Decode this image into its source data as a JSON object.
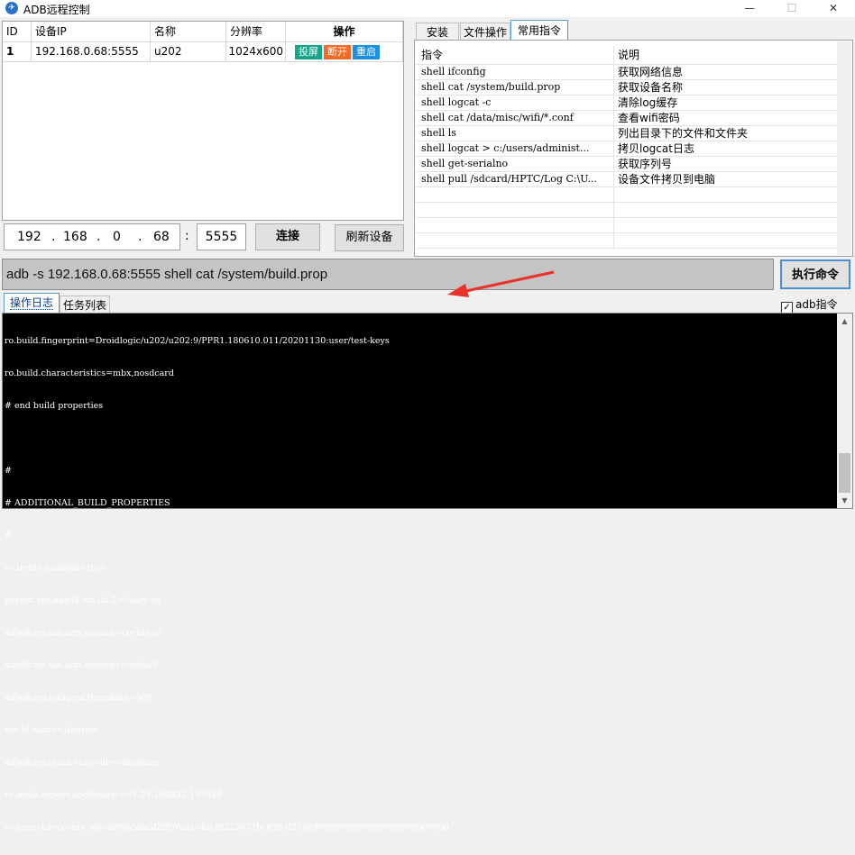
{
  "window": {
    "title": "ADB远程控制",
    "min": "—",
    "max": "☐",
    "close": "✕"
  },
  "device_table": {
    "headers": {
      "id": "ID",
      "ip": "设备IP",
      "name": "名称",
      "res": "分辨率",
      "ops": "操作"
    },
    "rows": [
      {
        "id": "1",
        "ip": "192.168.0.68:5555",
        "name": "u202",
        "res": "1024x600",
        "btn_cast": "投屏",
        "btn_disconnect": "断开",
        "btn_reboot": "重启"
      }
    ]
  },
  "connection": {
    "ip1": "192",
    "ip2": "168",
    "ip3": "0",
    "ip4": "68",
    "dot": ".",
    "colon": ":",
    "port": "5555",
    "connect_label": "连接",
    "refresh_label": "刷新设备"
  },
  "right_tabs": {
    "install": "安装",
    "files": "文件操作",
    "commands": "常用指令"
  },
  "commands": {
    "header_cmd": "指令",
    "header_desc": "说明",
    "rows": [
      {
        "cmd": "shell ifconfig",
        "desc": "获取网络信息"
      },
      {
        "cmd": "shell cat /system/build.prop",
        "desc": "获取设备名称"
      },
      {
        "cmd": "shell logcat -c",
        "desc": "清除log缓存"
      },
      {
        "cmd": "shell cat /data/misc/wifi/*.conf",
        "desc": "查看wifi密码"
      },
      {
        "cmd": "shell ls",
        "desc": "列出目录下的文件和文件夹"
      },
      {
        "cmd": "shell logcat > c:/users/administ...",
        "desc": "拷贝logcat日志"
      },
      {
        "cmd": "shell get-serialno",
        "desc": "获取序列号"
      },
      {
        "cmd": "shell pull /sdcard/HPTC/Log C:\\U...",
        "desc": "设备文件拷贝到电脑"
      }
    ]
  },
  "command_input": {
    "value": "adb -s 192.168.0.68:5555 shell cat /system/build.prop",
    "execute_label": "执行命令"
  },
  "log_tabs": {
    "log": "操作日志",
    "tasks": "任务列表"
  },
  "adb_checkbox": {
    "label": "adb指令",
    "checked": "✓"
  },
  "console": {
    "lines": [
      "ro.build.fingerprint=Droidlogic/u202/u202:9/PPR1.180610.011/20201130:user/test-keys",
      "ro.build.characteristics=mbx,nosdcard",
      "# end build properties",
      "",
      "#",
      "# ADDITIONAL_BUILD_PROPERTIES",
      "#",
      "ro.treble.enabled=true",
      "persist.sys.dalvik.vm.lib.2=libart.so",
      "dalvik.vm.isa.arm.variant=cortex-a9",
      "dalvik.vm.isa.arm.features=default",
      "dalvik.vm.lockprof.threshold=500",
      "net.bt.name=Android",
      "dalvik.vm.stack-trace-dir=/data/anr",
      "ro.build.expect.bootloader=01.01.180822.145544",
      "ro.expect.recovery_id=0x69a5da5f2f97fcd1c4ccfd322637bc6593f250e9000000000000000000000000"
    ]
  },
  "colors": {
    "cast": "#17a589",
    "disconnect": "#f26b2a",
    "reboot": "#1e90e0",
    "arrow": "#e8322b"
  }
}
